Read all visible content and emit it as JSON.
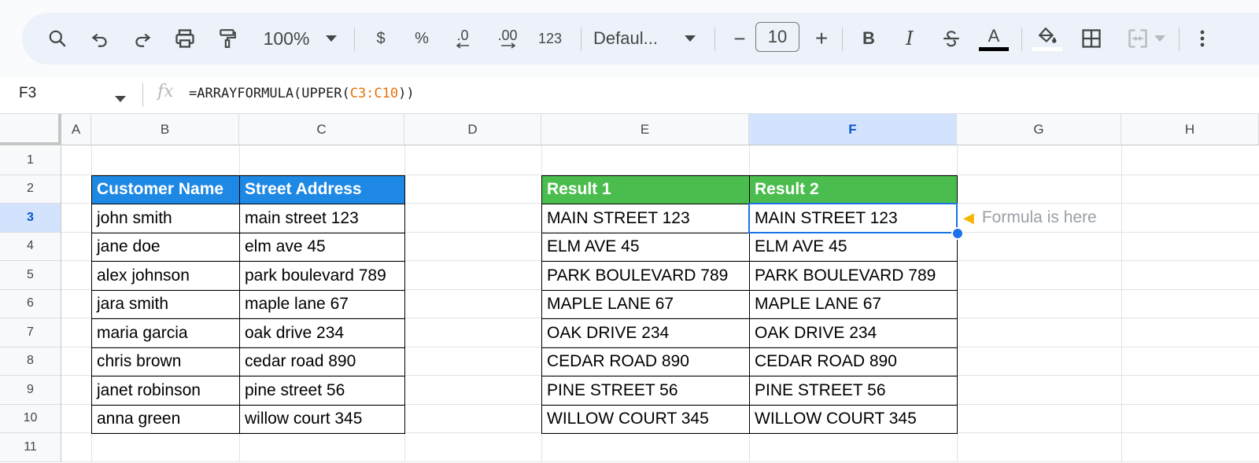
{
  "toolbar": {
    "zoom": "100%",
    "currency_label": "$",
    "percent_label": "%",
    "decrease_decimal_label": ".0",
    "increase_decimal_label": ".00",
    "number_format_label": "123",
    "font_name": "Defaul...",
    "font_size": "10",
    "minus_label": "−",
    "plus_label": "+",
    "bold_label": "B",
    "italic_label": "I",
    "text_color_label": "A",
    "text_color": "#000000"
  },
  "formula_bar": {
    "cell_ref": "F3",
    "fx_label": "fx",
    "formula_prefix": "=ARRAYFORMULA(UPPER(",
    "formula_range": "C3:C10",
    "formula_suffix": "))"
  },
  "columns": [
    "A",
    "B",
    "C",
    "D",
    "E",
    "F",
    "G",
    "H"
  ],
  "rows": [
    "1",
    "2",
    "3",
    "4",
    "5",
    "6",
    "7",
    "8",
    "9",
    "10",
    "11"
  ],
  "selected_column": "F",
  "selected_row": "3",
  "source_table": {
    "headers": [
      "Customer Name",
      "Street Address"
    ],
    "rows": [
      [
        "john smith",
        "main street 123"
      ],
      [
        "jane doe",
        "elm ave 45"
      ],
      [
        "alex johnson",
        "park boulevard 789"
      ],
      [
        "jara smith",
        "maple lane 67"
      ],
      [
        "maria garcia",
        "oak drive 234"
      ],
      [
        "chris brown",
        "cedar road 890"
      ],
      [
        "janet robinson",
        "pine street 56"
      ],
      [
        "anna green",
        "willow court 345"
      ]
    ]
  },
  "result_table": {
    "headers": [
      "Result 1",
      "Result 2"
    ],
    "rows": [
      [
        "MAIN STREET 123",
        "MAIN STREET 123"
      ],
      [
        "ELM AVE 45",
        "ELM AVE 45"
      ],
      [
        "PARK BOULEVARD 789",
        "PARK BOULEVARD 789"
      ],
      [
        "MAPLE LANE 67",
        "MAPLE LANE 67"
      ],
      [
        "OAK DRIVE 234",
        "OAK DRIVE 234"
      ],
      [
        "CEDAR ROAD 890",
        "CEDAR ROAD 890"
      ],
      [
        "PINE STREET 56",
        "PINE STREET 56"
      ],
      [
        "WILLOW COURT 345",
        "WILLOW COURT 345"
      ]
    ]
  },
  "annotation": {
    "icon": "pointing-hand-icon",
    "text": "Formula is here"
  },
  "colors": {
    "source_header": "#1e88e5",
    "result_header": "#4bbd4e",
    "selection": "#1a73e8"
  }
}
